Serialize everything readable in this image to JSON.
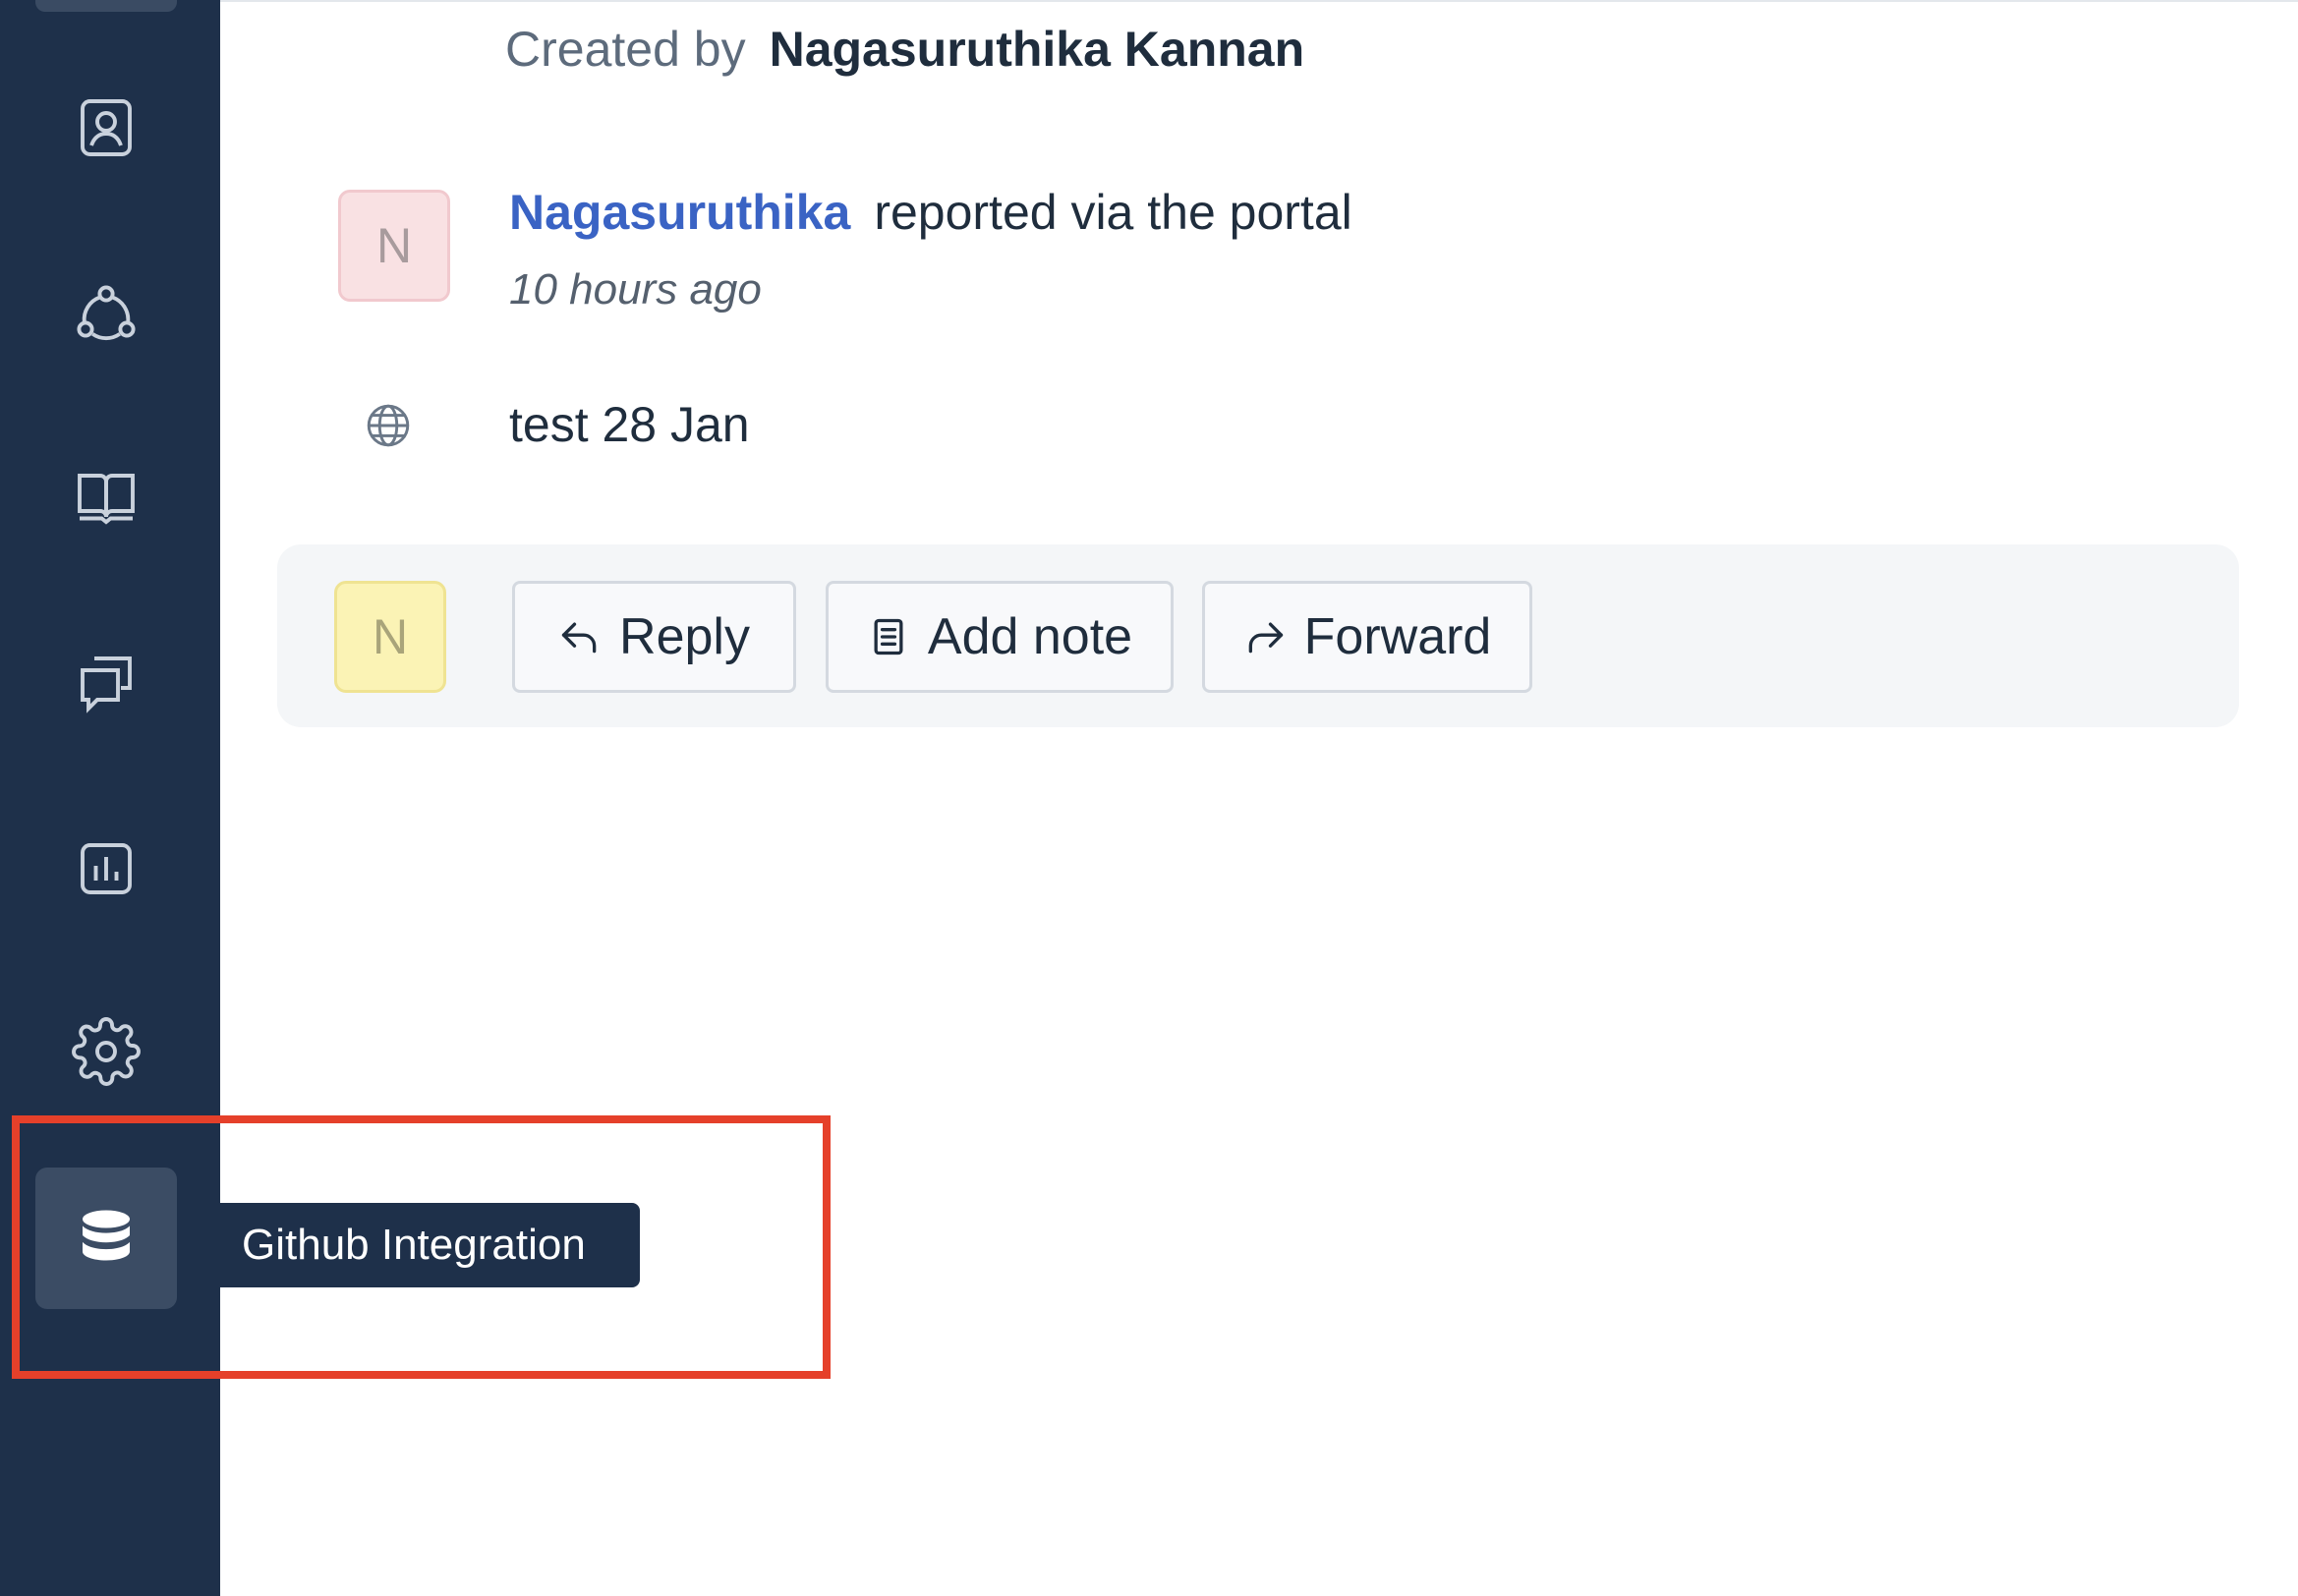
{
  "sidebar": {
    "items": [
      {
        "icon": "contact-card-icon"
      },
      {
        "icon": "team-network-icon"
      },
      {
        "icon": "knowledge-book-icon"
      },
      {
        "icon": "conversations-icon"
      },
      {
        "icon": "reports-chart-icon"
      },
      {
        "icon": "settings-gear-icon"
      },
      {
        "icon": "database-icon",
        "active": true
      }
    ],
    "tooltip": "Github Integration"
  },
  "ticket": {
    "created_label": "Created by",
    "created_by": "Nagasuruthika Kannan",
    "activity": {
      "avatar_initial": "N",
      "author": "Nagasuruthika",
      "action": "reported via the portal",
      "time": "10 hours ago"
    },
    "subject_icon": "globe-icon",
    "subject": "test 28 Jan"
  },
  "composer": {
    "avatar_initial": "N",
    "reply_label": "Reply",
    "note_label": "Add note",
    "forward_label": "Forward"
  },
  "colors": {
    "sidebar_bg": "#1e304a",
    "link": "#3a63c4",
    "highlight": "#e5402a"
  }
}
